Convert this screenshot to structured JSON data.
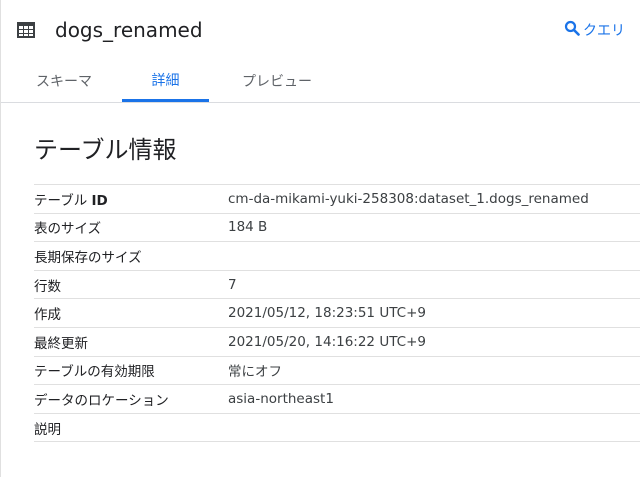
{
  "header": {
    "title": "dogs_renamed",
    "query_label": "クエリ",
    "table_icon": "table-grid-icon",
    "query_icon": "search-icon"
  },
  "tabs": [
    {
      "label": "スキーマ",
      "active": false
    },
    {
      "label": "詳細",
      "active": true
    },
    {
      "label": "プレビュー",
      "active": false
    }
  ],
  "section": {
    "title": "テーブル情報"
  },
  "info_rows": [
    {
      "key": "テーブル",
      "key_suffix": "ID",
      "value": "cm-da-mikami-yuki-258308:dataset_1.dogs_renamed"
    },
    {
      "key": "表のサイズ",
      "value": "184 B"
    },
    {
      "key": "長期保存のサイズ",
      "value": ""
    },
    {
      "key": "行数",
      "value": "7"
    },
    {
      "key": "作成",
      "value": "2021/05/12, 18:23:51 UTC+9"
    },
    {
      "key": "最終更新",
      "value": "2021/05/20, 14:16:22 UTC+9"
    },
    {
      "key": "テーブルの有効期限",
      "value": "常にオフ"
    },
    {
      "key": "データのロケーション",
      "value": "asia-northeast1"
    },
    {
      "key": "説明",
      "value": ""
    }
  ],
  "colors": {
    "accent": "#1a73e8",
    "text": "#202124",
    "muted": "#5f6368",
    "divider": "#e0e0e0"
  }
}
